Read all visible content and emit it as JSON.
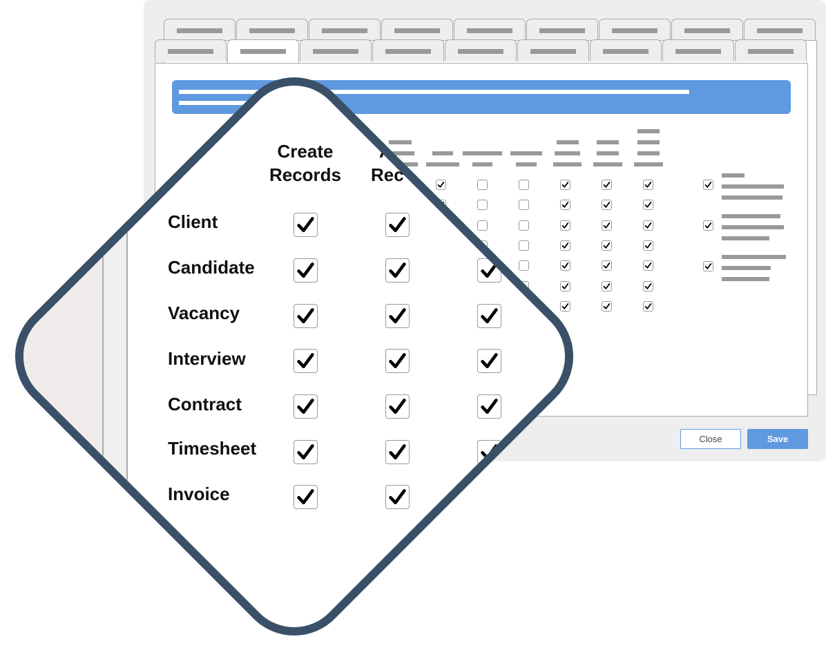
{
  "window": {
    "back_tab_count": 9,
    "front_tab_count": 9,
    "active_front_tab": 1,
    "buttons": {
      "close": "Close",
      "save": "Save"
    }
  },
  "colors": {
    "accent": "#5f99df",
    "diamond_border": "#3a5068",
    "placeholder": "#999999"
  },
  "permission_grid": {
    "columns_checked": [
      true,
      false,
      false,
      true,
      true,
      true
    ],
    "row_count": 7
  },
  "side_options": [
    {
      "checked": true
    },
    {
      "checked": true
    },
    {
      "checked": true
    }
  ],
  "zoom_view": {
    "headers": [
      {
        "line1": "Create",
        "line2": "Records"
      },
      {
        "line1": "A",
        "line2": "Rec"
      }
    ],
    "rows": [
      {
        "label": "Client",
        "checked": [
          true,
          true,
          true
        ]
      },
      {
        "label": "Candidate",
        "checked": [
          true,
          true,
          true
        ]
      },
      {
        "label": "Vacancy",
        "checked": [
          true,
          true,
          true
        ]
      },
      {
        "label": "Interview",
        "checked": [
          true,
          true,
          true
        ]
      },
      {
        "label": "Contract",
        "checked": [
          true,
          true,
          true
        ]
      },
      {
        "label": "Timesheet",
        "checked": [
          true,
          true,
          true
        ]
      },
      {
        "label": "Invoice",
        "checked": [
          true,
          true,
          true
        ]
      }
    ]
  },
  "icons": {
    "check": "checkmark-icon"
  }
}
